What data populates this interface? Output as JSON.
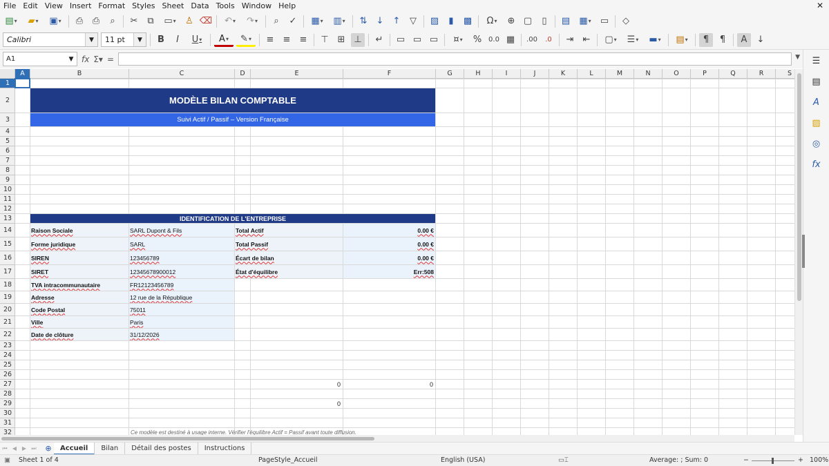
{
  "menu": [
    "File",
    "Edit",
    "View",
    "Insert",
    "Format",
    "Styles",
    "Sheet",
    "Data",
    "Tools",
    "Window",
    "Help"
  ],
  "font_name": "Calibri",
  "font_size": "11 pt",
  "name_box": "A1",
  "formula_value": "",
  "columns": [
    "A",
    "B",
    "C",
    "D",
    "E",
    "F",
    "G",
    "H",
    "I",
    "J",
    "K",
    "L",
    "M",
    "N",
    "O",
    "P",
    "Q",
    "R",
    "S"
  ],
  "rows": [
    "1",
    "2",
    "3",
    "4",
    "5",
    "6",
    "7",
    "8",
    "9",
    "10",
    "11",
    "12",
    "13",
    "14",
    "15",
    "16",
    "17",
    "18",
    "19",
    "20",
    "21",
    "22",
    "23",
    "24",
    "25",
    "26",
    "27",
    "28",
    "29",
    "30",
    "31",
    "32"
  ],
  "sheet": {
    "title": "MODÈLE BILAN COMPTABLE",
    "subtitle": "Suivi Actif / Passif – Version Française",
    "ident_header": "IDENTIFICATION DE L'ENTREPRISE",
    "ident": [
      {
        "label": "Raison Sociale",
        "value": "SARL Dupont & Fils"
      },
      {
        "label": "Forme juridique",
        "value": "SARL"
      },
      {
        "label": "SIREN",
        "value": "123456789"
      },
      {
        "label": "SIRET",
        "value": "12345678900012"
      },
      {
        "label": "TVA intracommunautaire",
        "value": "FR12123456789"
      },
      {
        "label": "Adresse",
        "value": "12 rue de la République"
      },
      {
        "label": "Code Postal",
        "value": "75011"
      },
      {
        "label": "Ville",
        "value": "Paris"
      },
      {
        "label": "Date de clôture",
        "value": "31/12/2026"
      }
    ],
    "summary": [
      {
        "label": "Total Actif",
        "value": "0.00 €"
      },
      {
        "label": "Total Passif",
        "value": "0.00 €"
      },
      {
        "label": "Écart de bilan",
        "value": "0.00 €"
      },
      {
        "label": "État d'équilibre",
        "value": "Err:508"
      }
    ],
    "r27_e": "0",
    "r27_f": "0",
    "r29_e": "0",
    "note": "Ce modèle est destiné à usage interne. Vérifier l'équilibre Actif = Passif avant toute diffusion."
  },
  "tabs": [
    "Accueil",
    "Bilan",
    "Détail des postes",
    "Instructions"
  ],
  "active_tab": 0,
  "status": {
    "sheet_pos": "Sheet 1 of 4",
    "page_style": "PageStyle_Accueil",
    "language": "English (USA)",
    "summary": "Average: ; Sum: 0",
    "zoom": "100%"
  }
}
